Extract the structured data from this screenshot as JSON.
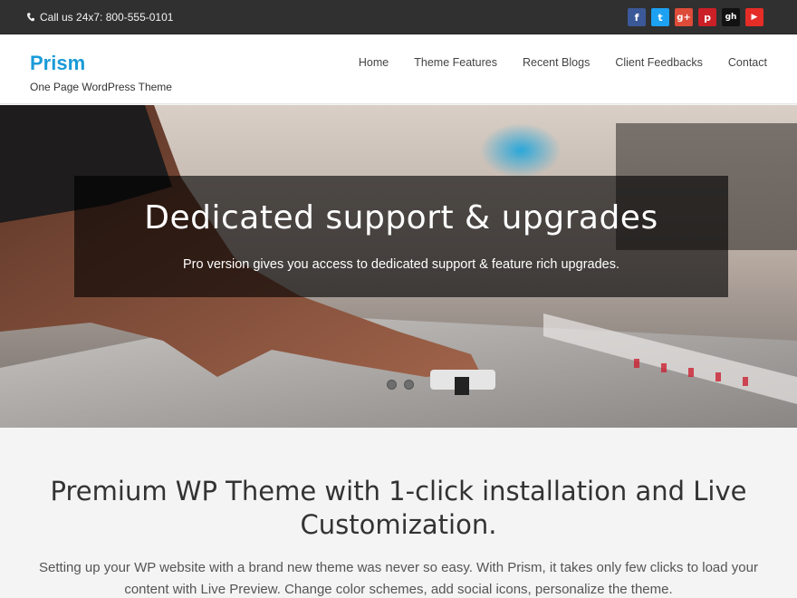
{
  "topbar": {
    "phone_text": "Call us 24x7: 800-555-0101",
    "socials": [
      {
        "name": "facebook",
        "glyph": "f",
        "color": "#3b5998"
      },
      {
        "name": "twitter",
        "glyph": "t",
        "color": "#1da1f2"
      },
      {
        "name": "google-plus",
        "glyph": "g+",
        "color": "#dd4b39"
      },
      {
        "name": "pinterest",
        "glyph": "p",
        "color": "#cb2027"
      },
      {
        "name": "github",
        "glyph": "gh",
        "color": "#111111"
      },
      {
        "name": "youtube",
        "glyph": "▶",
        "color": "#e52d27"
      }
    ]
  },
  "header": {
    "title": "Prism",
    "tagline": "One Page WordPress Theme",
    "nav": [
      "Home",
      "Theme Features",
      "Recent Blogs",
      "Client Feedbacks",
      "Contact"
    ],
    "accent": "#1a9bd7"
  },
  "hero": {
    "title": "Dedicated support & upgrades",
    "subtitle": "Pro version gives you access to dedicated support & feature rich upgrades.",
    "slide_count": 2
  },
  "main": {
    "heading": "Premium WP Theme with 1-click installation and Live Customization.",
    "text": "Setting up your WP website with a brand new theme was never so easy. With Prism, it takes only few clicks to load your content with Live Preview. Change color schemes, add social icons, personalize the theme."
  }
}
